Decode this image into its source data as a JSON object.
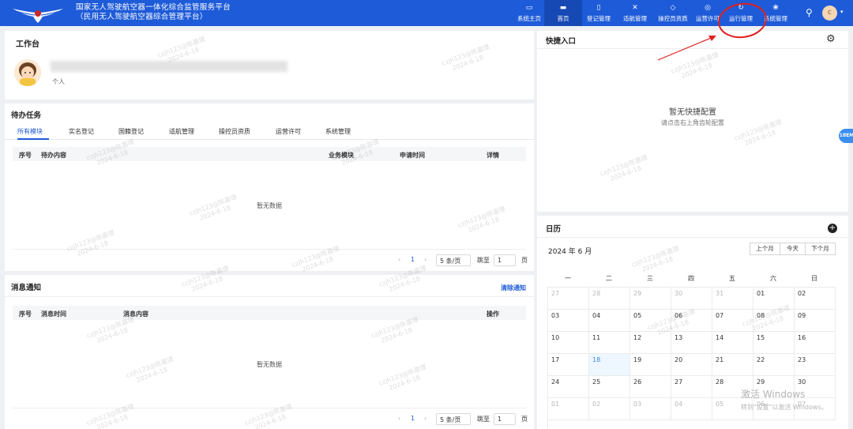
{
  "header": {
    "title_line1": "国家无人驾驶航空器一体化综合监管服务平台",
    "title_line2": "（民用无人驾驶航空器综合管理平台）",
    "nav": [
      {
        "label": "系统主页",
        "icon": "monitor-icon"
      },
      {
        "label": "首页",
        "icon": "desktop-icon",
        "active": true
      },
      {
        "label": "登记管理",
        "icon": "document-icon"
      },
      {
        "label": "适航管理",
        "icon": "drone-icon"
      },
      {
        "label": "操控员资质",
        "icon": "shield-icon"
      },
      {
        "label": "运营许可",
        "icon": "target-icon"
      },
      {
        "label": "运行管理",
        "icon": "cycle-icon"
      },
      {
        "label": "系统管理",
        "icon": "cluster-icon"
      }
    ],
    "avatar_letter": "c"
  },
  "workspace": {
    "title": "工作台",
    "role": "个人"
  },
  "todo": {
    "title": "待办任务",
    "tabs": [
      "所有模块",
      "实名登记",
      "国籍登记",
      "适航管理",
      "操控员资质",
      "运营许可",
      "系统管理"
    ],
    "columns": [
      "序号",
      "待办内容",
      "业务模块",
      "申请时间",
      "详情"
    ],
    "empty": "暂无数据",
    "pager": {
      "prev": "‹",
      "page": "1",
      "next": "›",
      "size": "5 条/页",
      "goto": "跳至",
      "goto_value": "1",
      "unit": "页"
    }
  },
  "messages": {
    "title": "消息通知",
    "clear": "清除通知",
    "columns": [
      "序号",
      "消息时间",
      "消息内容",
      "操作"
    ],
    "empty": "暂无数据",
    "pager": {
      "prev": "‹",
      "page": "1",
      "next": "›",
      "size": "5 条/页",
      "goto": "跳至",
      "goto_value": "1",
      "unit": "页"
    }
  },
  "quick": {
    "title": "快捷入口",
    "empty": "暂无快捷配置",
    "hint": "请点击右上角齿轮配置"
  },
  "calendar": {
    "title": "日历",
    "month": "2024 年 6 月",
    "buttons": [
      "上个月",
      "今天",
      "下个月"
    ],
    "weekdays": [
      "一",
      "二",
      "三",
      "四",
      "五",
      "六",
      "日"
    ],
    "weeks": [
      [
        "27",
        "28",
        "29",
        "30",
        "31",
        "01",
        "02"
      ],
      [
        "03",
        "04",
        "05",
        "06",
        "07",
        "08",
        "09"
      ],
      [
        "10",
        "11",
        "12",
        "13",
        "14",
        "15",
        "16"
      ],
      [
        "17",
        "18",
        "19",
        "20",
        "21",
        "22",
        "23"
      ],
      [
        "24",
        "25",
        "26",
        "27",
        "28",
        "29",
        "30"
      ],
      [
        "01",
        "02",
        "03",
        "04",
        "05",
        "06",
        "07"
      ]
    ],
    "today": "18"
  },
  "watermark": {
    "user": "czjh123@陈嘉璟",
    "date": "2024-6-18"
  },
  "windows": {
    "line1": "激活 Windows",
    "line2": "转到\"设置\"以激活 Windows。"
  },
  "side_badge": "18EM",
  "colors": {
    "primary": "#1e5bd8",
    "header_active": "#1749b4",
    "today_bg": "#eef6ff",
    "annotation": "#e02020"
  }
}
